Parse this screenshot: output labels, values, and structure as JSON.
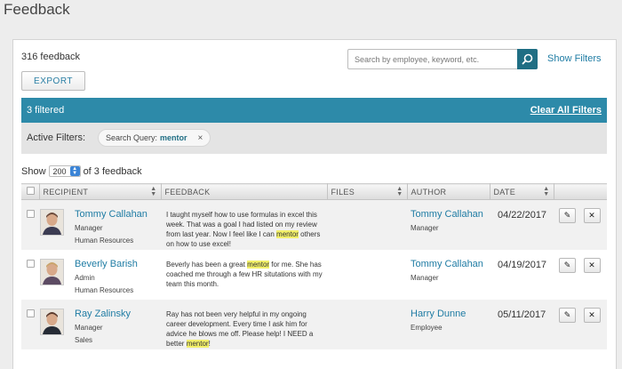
{
  "page": {
    "title": "Feedback"
  },
  "toolbar": {
    "count_label": "316 feedback",
    "export_label": "EXPORT",
    "search_placeholder": "Search by employee, keyword, etc.",
    "show_filters_label": "Show Filters"
  },
  "filters": {
    "filtered_label": "3 filtered",
    "clear_all_label": "Clear All Filters",
    "active_label": "Active Filters:",
    "chip": {
      "key": "Search Query:",
      "value": "mentor",
      "remove": "×"
    }
  },
  "pagination": {
    "show_label": "Show",
    "page_size": "200",
    "of_label": "of 3 feedback"
  },
  "table": {
    "columns": [
      "RECIPIENT",
      "FEEDBACK",
      "FILES",
      "AUTHOR",
      "DATE"
    ],
    "rows": [
      {
        "recipient": {
          "name": "Tommy Callahan",
          "role": "Manager",
          "department": "Human Resources"
        },
        "feedback": {
          "before": "I taught myself how to use formulas in excel this week. That was a goal I had listed on my review from last year. Now I feel like I can ",
          "highlight": "mentor",
          "after": " others on how to use excel!"
        },
        "author": {
          "name": "Tommy Callahan",
          "role": "Manager"
        },
        "date": "04/22/2017"
      },
      {
        "recipient": {
          "name": "Beverly Barish",
          "role": "Admin",
          "department": "Human Resources"
        },
        "feedback": {
          "before": "Beverly has been a great ",
          "highlight": "mentor",
          "after": " for me. She has coached me through a few HR situtations with my team this month."
        },
        "author": {
          "name": "Tommy Callahan",
          "role": "Manager"
        },
        "date": "04/19/2017"
      },
      {
        "recipient": {
          "name": "Ray Zalinsky",
          "role": "Manager",
          "department": "Sales"
        },
        "feedback": {
          "before": "Ray has not been very helpful in my ongoing career development. Every time I ask him for advice he blows me off. Please help! I NEED a better ",
          "highlight": "mentor",
          "after": "!"
        },
        "author": {
          "name": "Harry Dunne",
          "role": "Employee"
        },
        "date": "05/11/2017"
      }
    ]
  },
  "actions": {
    "edit_icon": "pencil-icon",
    "delete_icon": "close-icon",
    "edit_glyph": "✎",
    "delete_glyph": "✕"
  },
  "colors": {
    "accent": "#2d8aa9",
    "link": "#1f7ca4",
    "highlight": "#f2f06a",
    "search_button": "#1f6e84"
  }
}
